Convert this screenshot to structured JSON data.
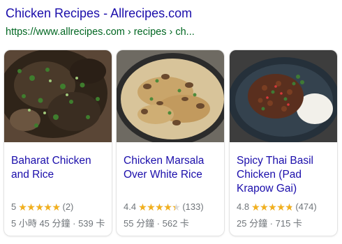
{
  "result": {
    "title": "Chicken Recipes - Allrecipes.com",
    "url": "https://www.allrecipes.com › recipes › ch..."
  },
  "colors": {
    "link": "#1a0dab",
    "url": "#006621",
    "star": "#f2b01e",
    "meta": "#70757a"
  },
  "star_glyphs": {
    "full": "★★★★★"
  },
  "cards": [
    {
      "title": "Baharat Chicken and Rice",
      "rating": "5",
      "rating_value": 5,
      "reviews": "(2)",
      "meta": "5 小時 45 分鐘 · 539 卡",
      "image": "baharat-chicken-photo"
    },
    {
      "title": "Chicken Marsala Over White Rice",
      "rating": "4.4",
      "rating_value": 4.4,
      "reviews": "(133)",
      "meta": "55 分鐘 · 562 卡",
      "image": "chicken-marsala-photo"
    },
    {
      "title": "Spicy Thai Basil Chicken (Pad Krapow Gai)",
      "rating": "4.8",
      "rating_value": 4.8,
      "reviews": "(474)",
      "meta": "25 分鐘 · 715 卡",
      "image": "thai-basil-chicken-photo"
    }
  ]
}
